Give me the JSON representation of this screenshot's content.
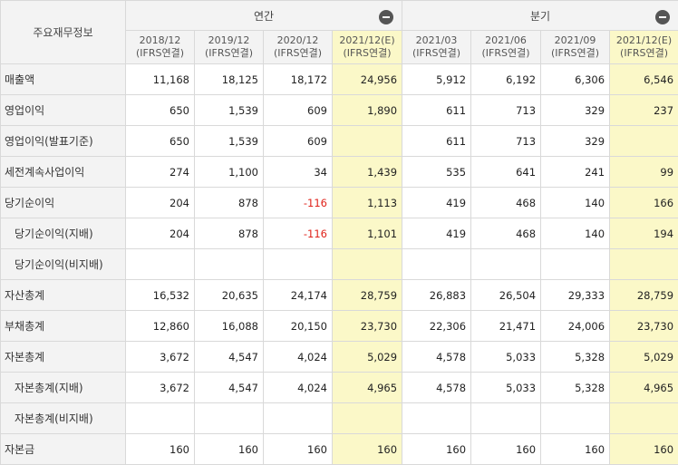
{
  "table": {
    "title": "주요재무정보",
    "groups": [
      {
        "label": "연간",
        "collapse_icon": "minus-circle-icon"
      },
      {
        "label": "분기",
        "collapse_icon": "minus-circle-icon"
      }
    ],
    "columns": [
      {
        "period": "2018/12",
        "basis": "(IFRS연결)",
        "estimate": false
      },
      {
        "period": "2019/12",
        "basis": "(IFRS연결)",
        "estimate": false
      },
      {
        "period": "2020/12",
        "basis": "(IFRS연결)",
        "estimate": false
      },
      {
        "period": "2021/12(E)",
        "basis": "(IFRS연결)",
        "estimate": true
      },
      {
        "period": "2021/03",
        "basis": "(IFRS연결)",
        "estimate": false
      },
      {
        "period": "2021/06",
        "basis": "(IFRS연결)",
        "estimate": false
      },
      {
        "period": "2021/09",
        "basis": "(IFRS연결)",
        "estimate": false
      },
      {
        "period": "2021/12(E)",
        "basis": "(IFRS연결)",
        "estimate": true
      }
    ],
    "rows": [
      {
        "label": "매출액",
        "indent": false,
        "values": [
          "11,168",
          "18,125",
          "18,172",
          "24,956",
          "5,912",
          "6,192",
          "6,306",
          "6,546"
        ]
      },
      {
        "label": "영업이익",
        "indent": false,
        "values": [
          "650",
          "1,539",
          "609",
          "1,890",
          "611",
          "713",
          "329",
          "237"
        ]
      },
      {
        "label": "영업이익(발표기준)",
        "indent": false,
        "values": [
          "650",
          "1,539",
          "609",
          "",
          "611",
          "713",
          "329",
          ""
        ]
      },
      {
        "label": "세전계속사업이익",
        "indent": false,
        "values": [
          "274",
          "1,100",
          "34",
          "1,439",
          "535",
          "641",
          "241",
          "99"
        ]
      },
      {
        "label": "당기순이익",
        "indent": false,
        "values": [
          "204",
          "878",
          "-116",
          "1,113",
          "419",
          "468",
          "140",
          "166"
        ]
      },
      {
        "label": "당기순이익(지배)",
        "indent": true,
        "values": [
          "204",
          "878",
          "-116",
          "1,101",
          "419",
          "468",
          "140",
          "194"
        ]
      },
      {
        "label": "당기순이익(비지배)",
        "indent": true,
        "values": [
          "",
          "",
          "",
          "",
          "",
          "",
          "",
          ""
        ]
      },
      {
        "label": "자산총계",
        "indent": false,
        "values": [
          "16,532",
          "20,635",
          "24,174",
          "28,759",
          "26,883",
          "26,504",
          "29,333",
          "28,759"
        ]
      },
      {
        "label": "부채총계",
        "indent": false,
        "values": [
          "12,860",
          "16,088",
          "20,150",
          "23,730",
          "22,306",
          "21,471",
          "24,006",
          "23,730"
        ]
      },
      {
        "label": "자본총계",
        "indent": false,
        "values": [
          "3,672",
          "4,547",
          "4,024",
          "5,029",
          "4,578",
          "5,033",
          "5,328",
          "5,029"
        ]
      },
      {
        "label": "자본총계(지배)",
        "indent": true,
        "values": [
          "3,672",
          "4,547",
          "4,024",
          "4,965",
          "4,578",
          "5,033",
          "5,328",
          "4,965"
        ]
      },
      {
        "label": "자본총계(비지배)",
        "indent": true,
        "values": [
          "",
          "",
          "",
          "",
          "",
          "",
          "",
          ""
        ]
      },
      {
        "label": "자본금",
        "indent": false,
        "values": [
          "160",
          "160",
          "160",
          "160",
          "160",
          "160",
          "160",
          "160"
        ]
      }
    ],
    "colors": {
      "estimate_bg": "#fbf8c8",
      "negative": "#e0231b",
      "header_bg": "#f3f3f3"
    }
  }
}
